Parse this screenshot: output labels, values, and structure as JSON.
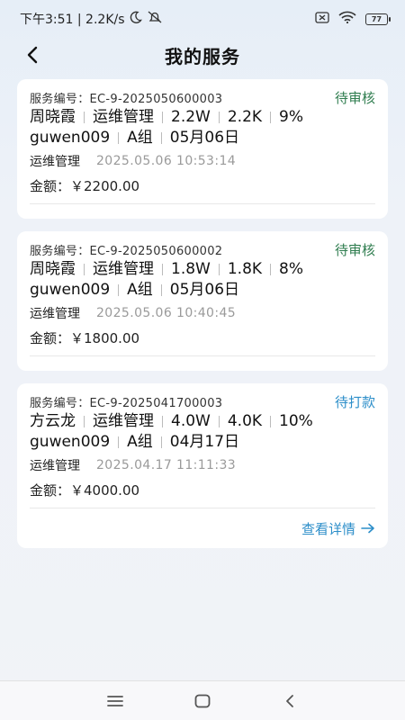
{
  "statusbar": {
    "time_speed": "下午3:51 | 2.2K/s",
    "battery": "77"
  },
  "header": {
    "title": "我的服务"
  },
  "orders": [
    {
      "order_label": "服务编号：EC-9-2025050600003",
      "status": "待审核",
      "name": "周晓霞",
      "type": "运维管理",
      "power": "2.2W",
      "capacity": "2.2K",
      "percent": "9%",
      "user": "guwen009",
      "group": "A组",
      "date": "05月06日",
      "type_label": "运维管理",
      "timestamp": "2025.05.06 10:53:14",
      "amount": "金额：￥2200.00"
    },
    {
      "order_label": "服务编号：EC-9-2025050600002",
      "status": "待审核",
      "name": "周晓霞",
      "type": "运维管理",
      "power": "1.8W",
      "capacity": "1.8K",
      "percent": "8%",
      "user": "guwen009",
      "group": "A组",
      "date": "05月06日",
      "type_label": "运维管理",
      "timestamp": "2025.05.06 10:40:45",
      "amount": "金额：￥1800.00"
    },
    {
      "order_label": "服务编号：EC-9-2025041700003",
      "status": "待打款",
      "name": "方云龙",
      "type": "运维管理",
      "power": "4.0W",
      "capacity": "4.0K",
      "percent": "10%",
      "user": "guwen009",
      "group": "A组",
      "date": "04月17日",
      "type_label": "运维管理",
      "timestamp": "2025.04.17 11:11:33",
      "amount": "金额：￥4000.00",
      "detail_link": "查看详情"
    }
  ],
  "colors": {
    "pending": "#2f7d4f",
    "topay": "#2c8ec9"
  }
}
